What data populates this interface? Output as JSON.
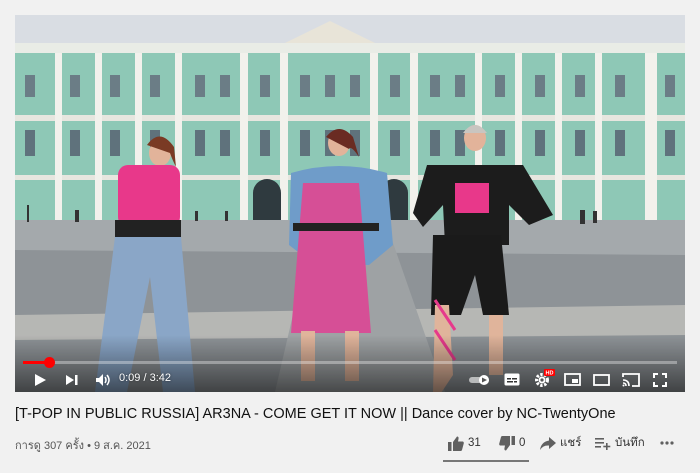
{
  "video": {
    "current_time": "0:09",
    "duration": "3:42",
    "progress_fraction": 0.04,
    "hd_badge": "HD"
  },
  "title": "[T-POP IN PUBLIC RUSSIA] AR3NA - COME GET IT NOW || Dance cover by NC-TwentyOne",
  "meta": {
    "views": "การดู 307 ครั้ง",
    "separator": "•",
    "date": "9 ส.ค. 2021"
  },
  "actions": {
    "like_count": "31",
    "dislike_count": "0",
    "share_label": "แชร์",
    "save_label": "บันทึก",
    "like_ratio": 1.0
  },
  "colors": {
    "progress": "#ff0000",
    "page_bg": "#f1f1f1",
    "palace_facade": "#8fc9b8",
    "top_pink": "#e8388a"
  },
  "icons": [
    "play-icon",
    "next-icon",
    "volume-icon",
    "autoplay-toggle-icon",
    "subtitles-icon",
    "settings-icon",
    "miniplayer-icon",
    "theater-icon",
    "cast-icon",
    "fullscreen-icon",
    "thumbs-up-icon",
    "thumbs-down-icon",
    "share-icon",
    "save-playlist-icon",
    "more-icon"
  ]
}
